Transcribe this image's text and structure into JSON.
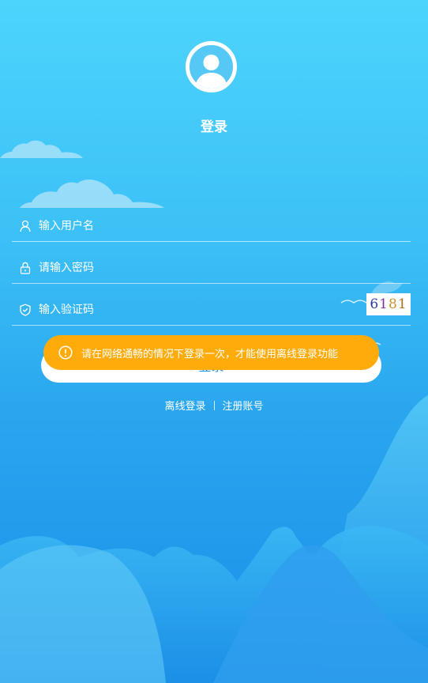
{
  "page": {
    "title": "登录"
  },
  "form": {
    "username_placeholder": "输入用户名",
    "password_placeholder": "请输入密码",
    "captcha_placeholder": "输入验证码",
    "captcha_code": "6181"
  },
  "login_button_label": "登录",
  "toast": {
    "message": "请在网络通畅的情况下登录一次，才能使用离线登录功能"
  },
  "links": {
    "offline_login": "离线登录",
    "register": "注册账号"
  },
  "icons": [
    "user-icon",
    "lock-icon",
    "shield-icon",
    "alert-icon",
    "avatar-icon"
  ],
  "colors": {
    "toast_bg": "#ffac0a",
    "button_text": "#1f8ee8"
  }
}
